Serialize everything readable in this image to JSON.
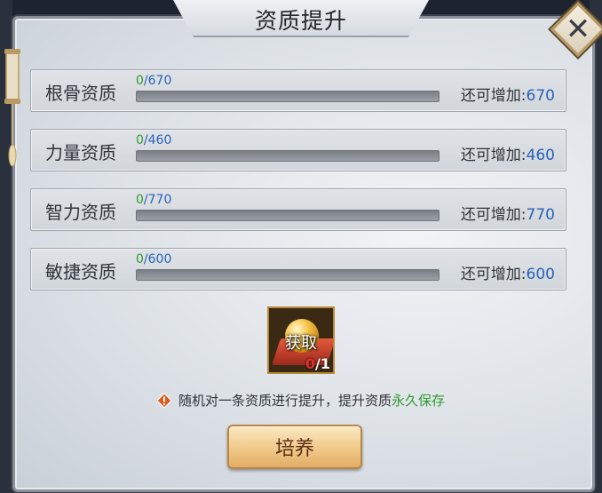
{
  "dialog": {
    "title": "资质提升"
  },
  "attributes": [
    {
      "label": "根骨资质",
      "current": "0",
      "max": "670",
      "remain_label": "还可增加:",
      "remain": "670",
      "progress": 0
    },
    {
      "label": "力量资质",
      "current": "0",
      "max": "460",
      "remain_label": "还可增加:",
      "remain": "460",
      "progress": 0
    },
    {
      "label": "智力资质",
      "current": "0",
      "max": "770",
      "remain_label": "还可增加:",
      "remain": "770",
      "progress": 0
    },
    {
      "label": "敏捷资质",
      "current": "0",
      "max": "600",
      "remain_label": "还可增加:",
      "remain": "600",
      "progress": 0
    }
  ],
  "item": {
    "action_label": "获取",
    "owned": "0",
    "required": "1",
    "icon": "golden-orb-icon"
  },
  "hint": {
    "text": "随机对一条资质进行提升，提升资质",
    "emphasis": "永久保存",
    "icon": "warning-diamond-icon"
  },
  "buttons": {
    "train_label": "培养",
    "close": "close-icon"
  },
  "colors": {
    "progress_fill": "#39a83e",
    "value_green": "#2f9a2f",
    "value_blue": "#2a62b8",
    "warning": "#e05a1c"
  }
}
